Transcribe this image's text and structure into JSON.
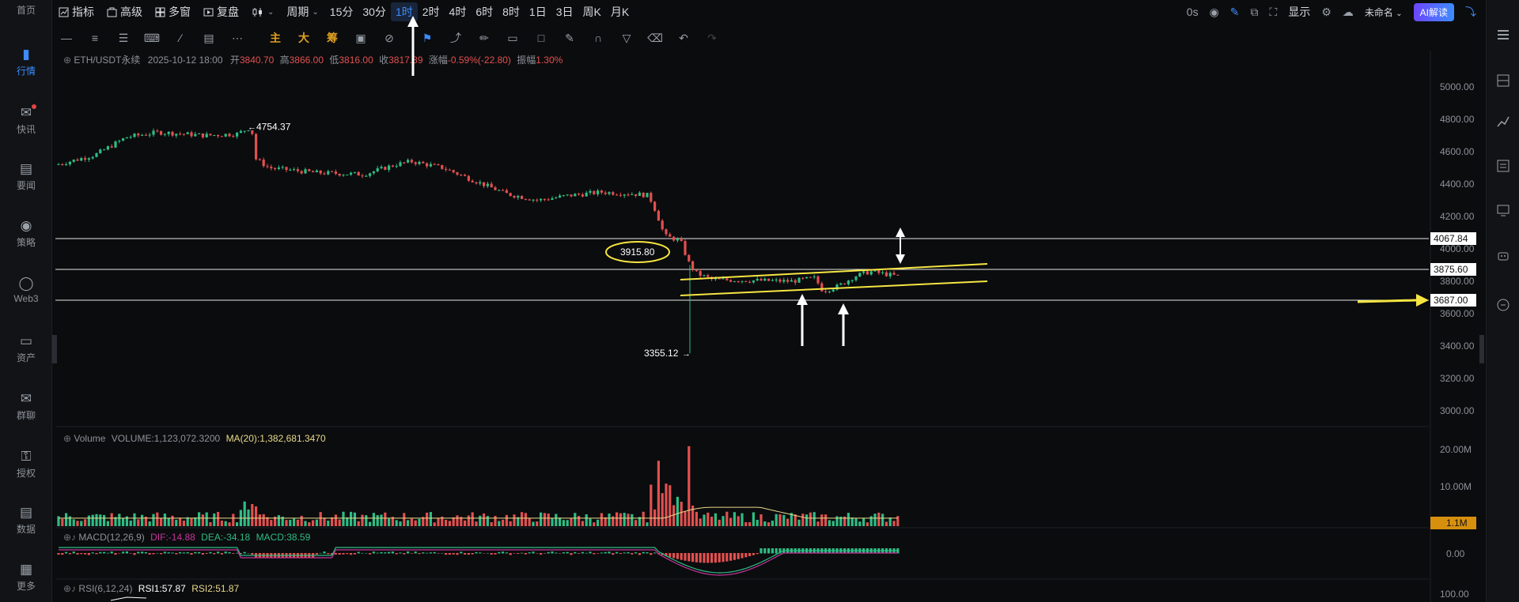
{
  "leftnav": [
    {
      "label": "首页",
      "icon": "home-icon"
    },
    {
      "label": "行情",
      "icon": "chart-bars-icon",
      "active": true
    },
    {
      "label": "快讯",
      "icon": "news-flash-icon",
      "dot": true
    },
    {
      "label": "要闻",
      "icon": "document-icon"
    },
    {
      "label": "策略",
      "icon": "robot-icon"
    },
    {
      "label": "Web3",
      "icon": "web3-icon"
    },
    {
      "label": "资产",
      "icon": "wallet-icon"
    },
    {
      "label": "群聊",
      "icon": "chat-icon"
    },
    {
      "label": "授权",
      "icon": "key-icon"
    },
    {
      "label": "数据",
      "icon": "data-icon"
    },
    {
      "label": "更多",
      "icon": "grid-icon"
    }
  ],
  "toolbar": {
    "indicator": "指标",
    "advanced": "高级",
    "multi_window": "多窗",
    "replay": "复盘",
    "period": "周期",
    "intervals": [
      "15分",
      "30分",
      "1时",
      "2时",
      "4时",
      "6时",
      "8时",
      "1日",
      "3日",
      "周K",
      "月K"
    ],
    "selected_interval": "1时",
    "countdown": "0s",
    "display": "显示",
    "unnamed": "未命名",
    "ai": "AI解读"
  },
  "drawing_tools": {
    "main": "主",
    "big": "大",
    "chips": "筹"
  },
  "info": {
    "symbol": "ETH/USDT永续",
    "datetime": "2025-10-12 18:00",
    "open_label": "开",
    "open": "3840.70",
    "high_label": "高",
    "high": "3866.00",
    "low_label": "低",
    "low": "3816.00",
    "close_label": "收",
    "close": "3817.89",
    "change_label": "涨幅",
    "change": "-0.59%(-22.80)",
    "amp_label": "振幅",
    "amp": "1.30%"
  },
  "volume_panel": {
    "label": "Volume",
    "volume": "VOLUME:1,123,072.3200",
    "ma": "MA(20):1,382,681.3470",
    "current_tag": "1.1M",
    "axis": [
      "20.00M",
      "10.00M"
    ]
  },
  "macd_panel": {
    "label": "MACD(12,26,9)",
    "dif": "DIF:-14.88",
    "dea": "DEA:-34.18",
    "macd": "MACD:38.59",
    "axis": [
      "0.00"
    ]
  },
  "rsi_panel": {
    "label": "RSI(6,12,24)",
    "rsi1": "RSI1:57.87",
    "rsi2": "RSI2:51.87",
    "axis": [
      "100.00"
    ]
  },
  "price_axis": [
    "5000.00",
    "4800.00",
    "4600.00",
    "4400.00",
    "4200.00",
    "4000.00",
    "3800.00",
    "3600.00",
    "3400.00",
    "3200.00",
    "3000.00"
  ],
  "annotations": {
    "high_marker": "4754.37",
    "low_marker": "3355.12",
    "circled_price": "3915.80",
    "level_tags": [
      "4067.84",
      "3875.60",
      "3687.00"
    ]
  },
  "colors": {
    "up": "#2ebd85",
    "down": "#e2504f",
    "accent": "#3c8cff",
    "trendline": "#f5e642",
    "ma_line": "#e8d98a"
  }
}
